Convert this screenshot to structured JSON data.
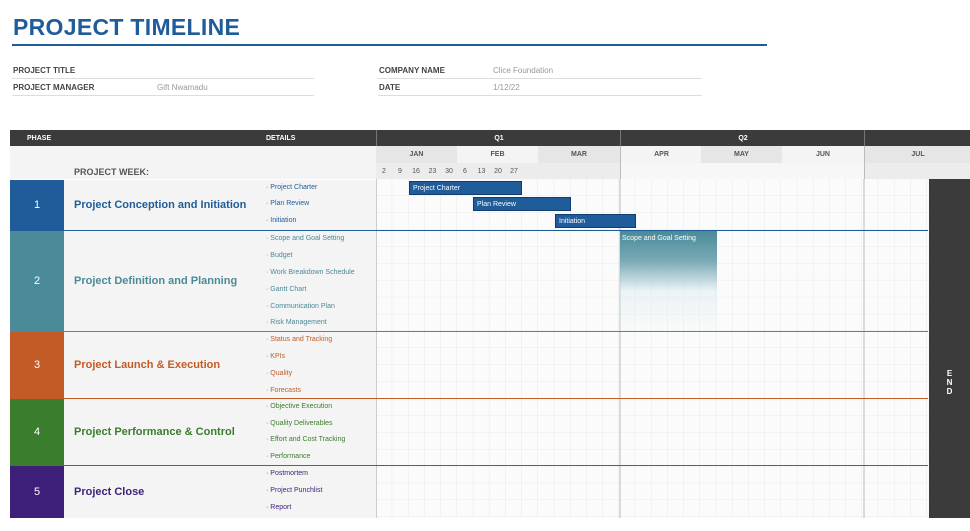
{
  "title": "PROJECT TIMELINE",
  "meta": {
    "project_title_label": "PROJECT TITLE",
    "project_title_value": "",
    "project_manager_label": "PROJECT MANAGER",
    "project_manager_value": "Gift Nwamadu",
    "company_name_label": "COMPANY NAME",
    "company_name_value": "Clice Foundation",
    "date_label": "DATE",
    "date_value": "1/12/22"
  },
  "header": {
    "phase": "PHASE",
    "details": "DETAILS",
    "project_week": "PROJECT WEEK:",
    "quarters": [
      "Q1",
      "Q2"
    ],
    "months": [
      "JAN",
      "FEB",
      "MAR",
      "APR",
      "MAY",
      "JUN",
      "JUL"
    ],
    "weeks": [
      "2",
      "9",
      "16",
      "23",
      "30",
      "6",
      "13",
      "20",
      "27"
    ]
  },
  "phases": [
    {
      "num": "1",
      "name": "Project Conception and Initiation",
      "color": "#1f5c99",
      "details": [
        "Project Charter",
        "Plan Review",
        "Initiation"
      ]
    },
    {
      "num": "2",
      "name": "Project Definition and Planning",
      "color": "#4a8a99",
      "details": [
        "Scope and Goal Setting",
        "Budget",
        "Work Breakdown Schedule",
        "Gantt Chart",
        "Communication Plan",
        "Risk Management"
      ]
    },
    {
      "num": "3",
      "name": "Project Launch & Execution",
      "color": "#c25b26",
      "details": [
        "Status and Tracking",
        "KPIs",
        "Quality",
        "Forecasts"
      ]
    },
    {
      "num": "4",
      "name": "Project Performance & Control",
      "color": "#3a7d2c",
      "details": [
        "Objective Execution",
        "Quality Deliverables",
        "Effort and Cost Tracking",
        "Performance"
      ]
    },
    {
      "num": "5",
      "name": "Project Close",
      "color": "#3d1f7a",
      "details": [
        "Postmortem",
        "Project Punchlist",
        "Report"
      ]
    }
  ],
  "bars": [
    "Project Charter",
    "Plan Review",
    "Initiation",
    "Scope and Goal Setting"
  ],
  "side_panel": {
    "text": "END"
  }
}
